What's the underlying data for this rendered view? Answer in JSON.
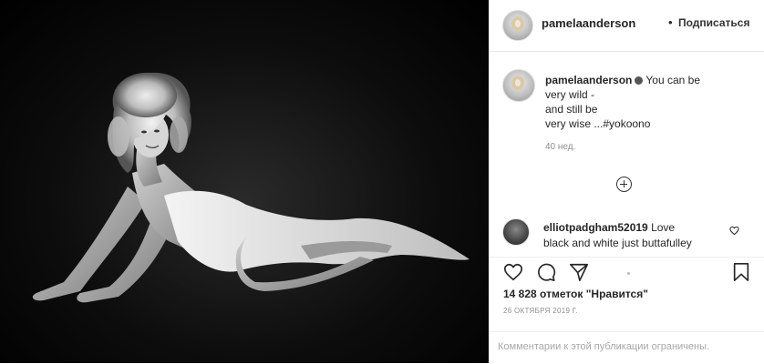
{
  "header": {
    "username": "pamelaanderson",
    "separator": "•",
    "follow_label": "Подписаться"
  },
  "caption": {
    "username": "pamelaanderson",
    "line1": "You can be",
    "line2": "very wild -",
    "line3": "and still be",
    "line4": "very wise ...#yokoono",
    "time": "40 нед."
  },
  "comment": {
    "username": "elliotpadgham52019",
    "text_part1": "Love",
    "text_part2": "black and white just buttafulley"
  },
  "likes": {
    "text": "14 828 отметок \"Нравится\""
  },
  "date": {
    "text": "26 ОКТЯБРЯ 2019 Г."
  },
  "footer": {
    "notice": "Комментарии к этой публикации ограничены."
  },
  "icons": {
    "header_avatar": "avatar-image",
    "caption_avatar": "avatar-image",
    "verified": "verified-badge-icon",
    "load_more": "plus-circle-icon",
    "comment_avatar": "avatar-image",
    "comment_like": "heart-icon",
    "like": "heart-icon",
    "comment": "comment-bubble-icon",
    "share": "paper-plane-icon",
    "save": "bookmark-icon"
  },
  "colors": {
    "text": "#262626",
    "muted": "#8e8e8e",
    "media_bg": "#000000"
  }
}
